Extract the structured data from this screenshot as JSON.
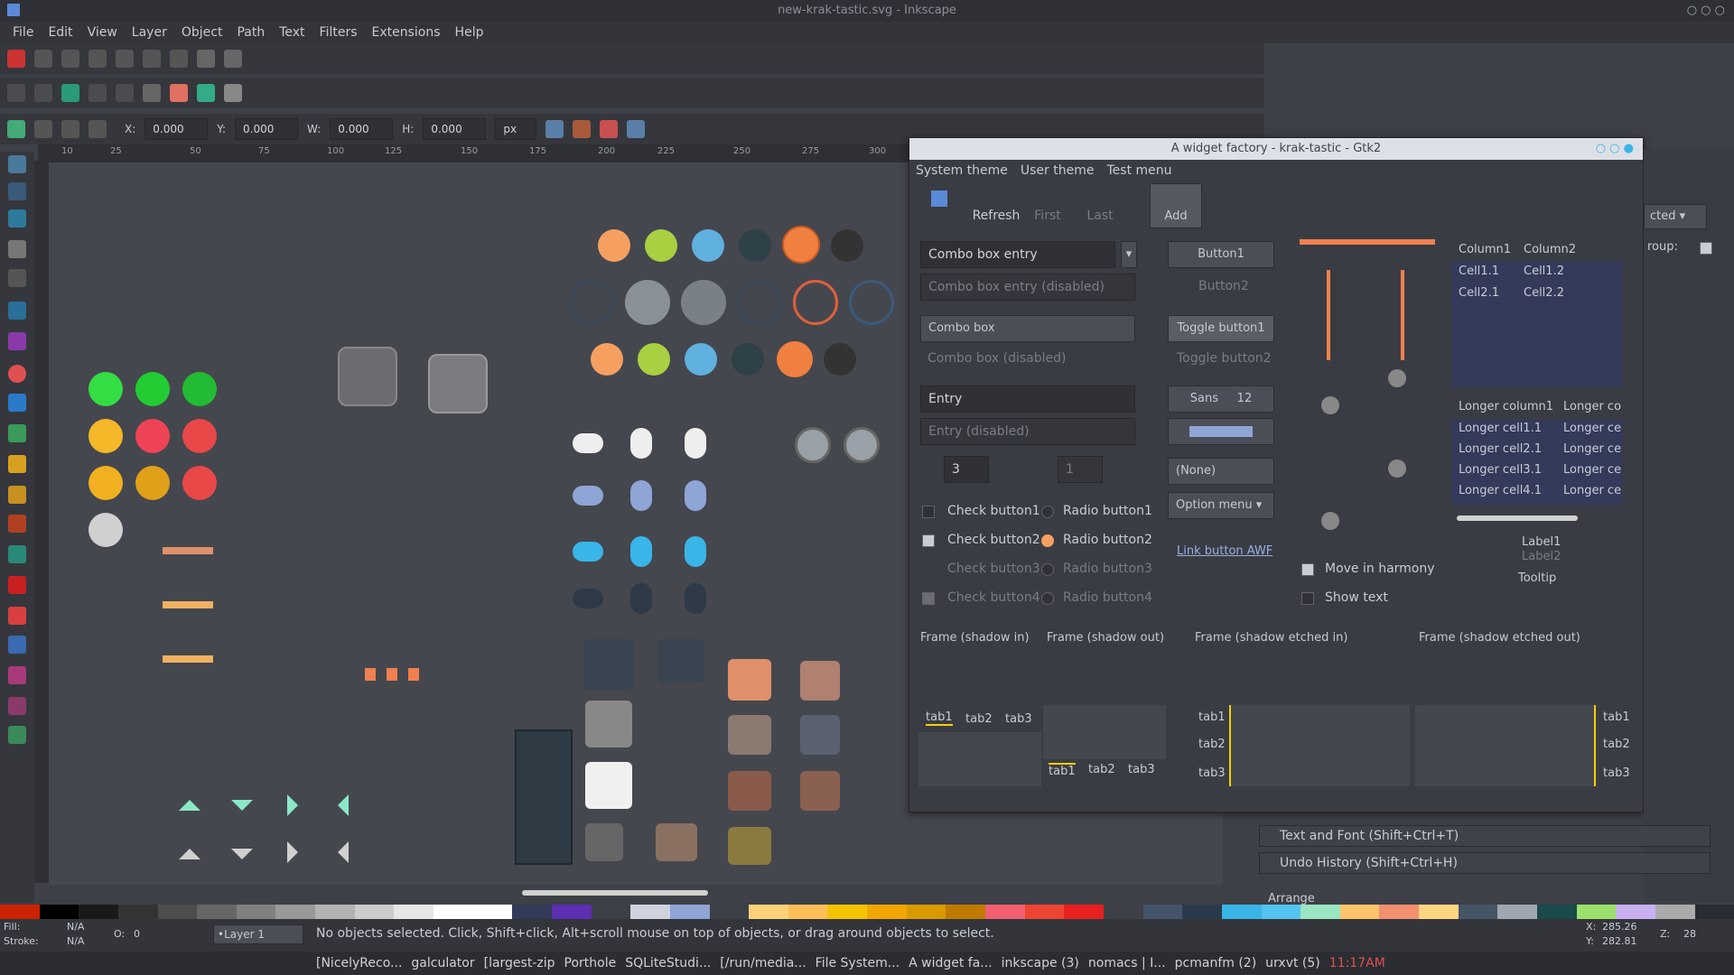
{
  "window": {
    "title": "new-krak-tastic.svg - Inkscape"
  },
  "menus": [
    "File",
    "Edit",
    "View",
    "Layer",
    "Object",
    "Path",
    "Text",
    "Filters",
    "Extensions",
    "Help"
  ],
  "coords": {
    "x_label": "X:",
    "x": "0.000",
    "y_label": "Y:",
    "y": "0.000",
    "w_label": "W:",
    "w": "0.000",
    "h_label": "H:",
    "h": "0.000",
    "unit": "px"
  },
  "ruler_ticks": [
    "10",
    "25",
    "50",
    "75",
    "100",
    "125",
    "150",
    "175",
    "200",
    "225",
    "250",
    "275",
    "300"
  ],
  "dialog": {
    "title": "A widget factory - krak-tastic - Gtk2",
    "menu": [
      "System theme",
      "User theme",
      "Test menu"
    ],
    "toolbar": [
      "Refresh",
      "First",
      "Last",
      "Add"
    ],
    "combo_entry": "Combo box entry",
    "combo_entry_dis": "Combo box entry (disabled)",
    "combo": "Combo box",
    "combo_dis": "Combo box (disabled)",
    "entry": "Entry",
    "entry_dis": "Entry (disabled)",
    "spin1": "3",
    "spin2": "1",
    "checks": [
      "Check button1",
      "Check button2",
      "Check button3",
      "Check button4"
    ],
    "radios": [
      "Radio button1",
      "Radio button2",
      "Radio button3",
      "Radio button4"
    ],
    "button1": "Button1",
    "button2": "Button2",
    "toggle1": "Toggle button1",
    "toggle2": "Toggle button2",
    "font_name": "Sans",
    "font_size": "12",
    "file_none": "(None)",
    "option_menu": "Option menu",
    "link": "Link button AWF",
    "move_harmony": "Move in harmony",
    "show_text": "Show text",
    "tree_headers": [
      "Column1",
      "Column2"
    ],
    "tree_rows": [
      [
        "Cell1.1",
        "Cell1.2"
      ],
      [
        "Cell2.1",
        "Cell2.2"
      ]
    ],
    "tree2_headers": [
      "Longer column1",
      "Longer co"
    ],
    "tree2_rows": [
      [
        "Longer cell1.1",
        "Longer ce"
      ],
      [
        "Longer cell2.1",
        "Longer ce"
      ],
      [
        "Longer cell3.1",
        "Longer ce"
      ],
      [
        "Longer cell4.1",
        "Longer ce"
      ]
    ],
    "label1": "Label1",
    "label2": "Label2",
    "tooltip": "Tooltip",
    "frames": [
      "Frame (shadow in)",
      "Frame (shadow out)",
      "Frame (shadow etched in)",
      "Frame (shadow etched out)"
    ],
    "tabs": [
      "tab1",
      "tab2",
      "tab3"
    ]
  },
  "dock": {
    "dropdown": "cted",
    "group_label": "roup:",
    "text_font": "Text and Font (Shift+Ctrl+T)",
    "undo": "Undo History (Shift+Ctrl+H)",
    "arrange": "Arrange"
  },
  "status": {
    "fill_label": "Fill:",
    "fill": "N/A",
    "stroke_label": "Stroke:",
    "stroke": "N/A",
    "opacity_label": "O:",
    "opacity": "0",
    "layer": "•Layer 1",
    "message": "No objects selected. Click, Shift+click, Alt+scroll mouse on top of objects, or drag around objects to select.",
    "x_label": "X:",
    "x": "285.26",
    "y_label": "Y:",
    "y": "282.81",
    "z_label": "Z:",
    "zoom": "28"
  },
  "taskbar": [
    "[NicelyReco...",
    "galculator",
    "[largest-zip",
    "Porthole",
    "SQLiteStudi...",
    "[/run/media...",
    "File System...",
    "A widget fa...",
    "inkscape (3)",
    "nomacs | I...",
    "pcmanfm (2)",
    "urxvt (5)"
  ],
  "clock": "11:17AM",
  "palette": [
    "#cc2200",
    "#000000",
    "#1a1a1a",
    "#333333",
    "#4d4d4d",
    "#666666",
    "#808080",
    "#999999",
    "#b3b3b3",
    "#cccccc",
    "#e6e6e6",
    "#ffffff",
    "#ffffff",
    "#333a5a",
    "#5b2fb0",
    "#3e4047",
    "#cfd3e0",
    "#8ea5d6",
    "#3e4047",
    "#ffd27a",
    "#ffbf58",
    "#f5c400",
    "#f0a500",
    "#d89a00",
    "#c07a00",
    "#f06070",
    "#ee4433",
    "#e82020",
    "#3e4047",
    "#44556a",
    "#2b3a4a",
    "#39b5e8",
    "#55c3f0",
    "#99e6c0",
    "#ffc36b",
    "#f29070",
    "#ffd580",
    "#445566",
    "#a0a6b0",
    "#1b4a4a",
    "#9ae06b",
    "#c9b0f0",
    "#aaaaaa",
    "#2a2c33"
  ]
}
